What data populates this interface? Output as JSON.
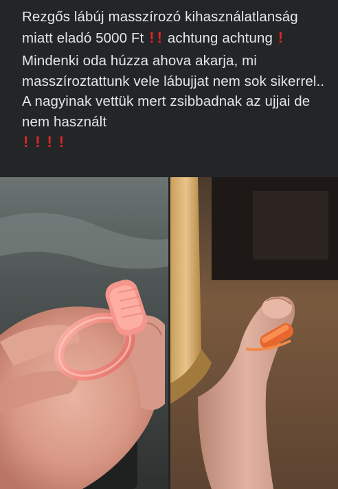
{
  "post": {
    "line1_a": "Rezgős lábúj masszírozó kihasználatlanság miatt eladó 5000 Ft",
    "line1_b": "achtung achtung",
    "paragraph2": "Mindenki oda húzza ahova akarja, mi masszíroztattunk vele lábujjat nem sok sikerrel.. A nagyinak vettük mert zsibbadnak az ujjai de nem használt",
    "emoji": "exclamation-mark",
    "accent_color": "#e0252b"
  },
  "photos": [
    {
      "name": "hand-holding-pink-ring"
    },
    {
      "name": "toe-with-ring"
    }
  ]
}
